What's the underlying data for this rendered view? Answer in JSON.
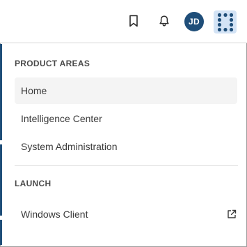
{
  "header": {
    "avatar_initials": "JD",
    "icons": [
      "bookmark-icon",
      "bell-icon",
      "apps-grid-icon"
    ],
    "accent_color": "#1f4e79",
    "apps_button_bg": "#d3e3f5"
  },
  "menu": {
    "product_areas_title": "PRODUCT AREAS",
    "product_areas": [
      {
        "label": "Home"
      },
      {
        "label": "Intelligence Center"
      },
      {
        "label": "System Administration"
      }
    ],
    "launch_title": "LAUNCH",
    "launch_items": [
      {
        "label": "Windows Client",
        "icon": "external-link-icon"
      }
    ]
  }
}
